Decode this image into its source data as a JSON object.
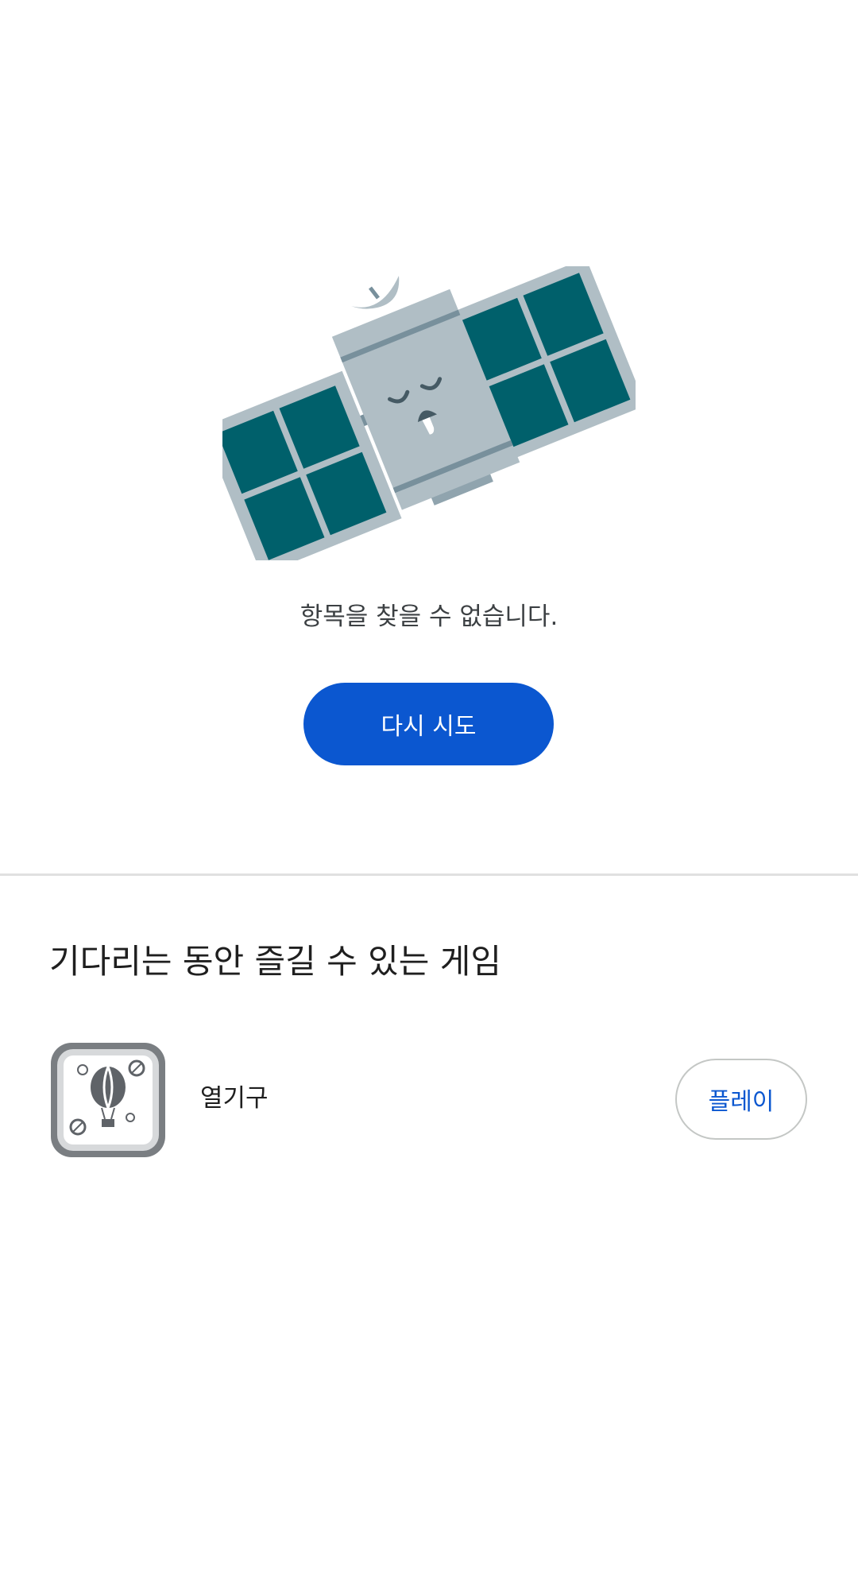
{
  "error": {
    "illustration_icon": "sleeping-satellite-icon",
    "message": "항목을 찾을 수 없습니다.",
    "retry_label": "다시 시도"
  },
  "games_section": {
    "title": "기다리는 동안 즐길 수 있는 게임",
    "games": [
      {
        "icon": "hot-air-balloon-icon",
        "name": "열기구",
        "play_label": "플레이"
      }
    ]
  },
  "colors": {
    "primary": "#0b57d0",
    "divider": "#e0e0e0",
    "satellite_body": "#b0bec5",
    "solar_panel": "#00606b"
  }
}
